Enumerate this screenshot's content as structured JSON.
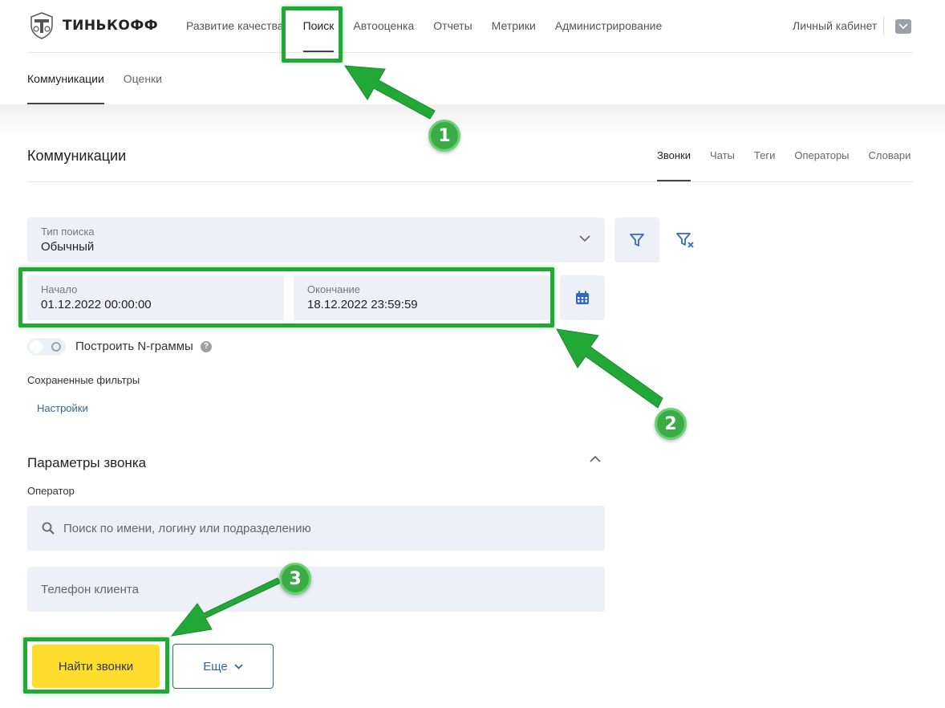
{
  "brand": {
    "name": "ТИНЬКОФФ"
  },
  "nav": {
    "items": [
      {
        "label": "Развитие качества"
      },
      {
        "label": "Поиск"
      },
      {
        "label": "Автооценка"
      },
      {
        "label": "Отчеты"
      },
      {
        "label": "Метрики"
      },
      {
        "label": "Администрирование"
      }
    ],
    "active_index": 1,
    "cabinet": "Личный кабинет"
  },
  "subnav": {
    "items": [
      {
        "label": "Коммуникации"
      },
      {
        "label": "Оценки"
      }
    ],
    "active_index": 0
  },
  "section": {
    "title": "Коммуникации",
    "tabs": [
      {
        "label": "Звонки"
      },
      {
        "label": "Чаты"
      },
      {
        "label": "Теги"
      },
      {
        "label": "Операторы"
      },
      {
        "label": "Словари"
      }
    ],
    "active_index": 0
  },
  "search_type": {
    "label": "Тип поиска",
    "value": "Обычный"
  },
  "period": {
    "start_label": "Начало",
    "start_value": "01.12.2022 00:00:00",
    "end_label": "Окончание",
    "end_value": "18.12.2022 23:59:59"
  },
  "ngram": {
    "label": "Построить N-граммы",
    "help": "?",
    "enabled": false
  },
  "saved_filters": {
    "title": "Сохраненные фильтры",
    "settings_link": "Настройки"
  },
  "call_params": {
    "title": "Параметры звонка",
    "operator_label": "Оператор",
    "operator_placeholder": "Поиск по имени, логину или подразделению",
    "phone_placeholder": "Телефон клиента"
  },
  "actions": {
    "find_label": "Найти звонки",
    "more_label": "Еще"
  },
  "annotations": {
    "step1": "1",
    "step2": "2",
    "step3": "3",
    "color": "#22a836"
  },
  "colors": {
    "accent_yellow": "#ffdd2d",
    "link_blue": "#336699",
    "field_bg": "#edf0f6"
  }
}
